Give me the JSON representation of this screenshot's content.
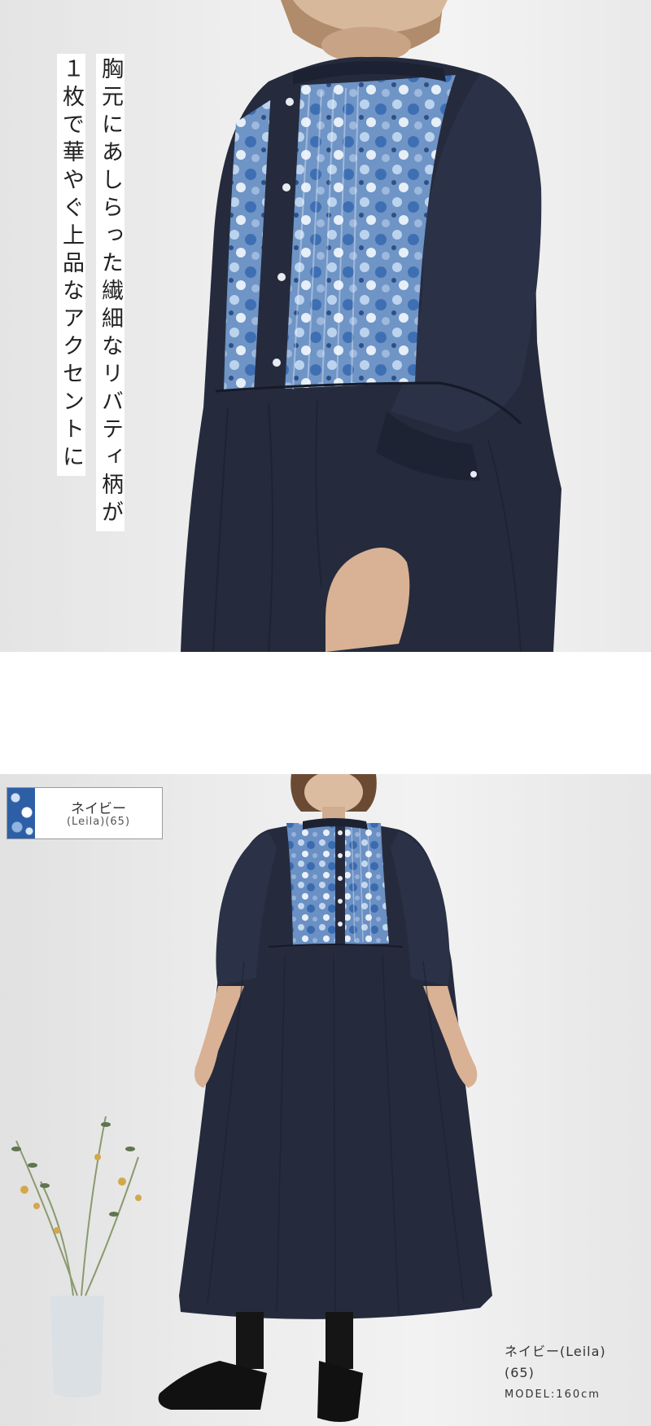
{
  "top_section": {
    "vertical_text": [
      "胸元にあしらった繊細なリバティ柄が",
      "１枚で華やぐ上品なアクセントに"
    ]
  },
  "bottom_section": {
    "color_label": {
      "name": "ネイビー",
      "code": "(Leila)(65)",
      "swatch_colors": [
        "#2d5fa7",
        "#cfe0f3",
        "#8fb4e0"
      ]
    },
    "caption": {
      "line1": "ネイビー(Leila)",
      "line2": "(65)",
      "model": "MODEL:160cm"
    }
  },
  "colors": {
    "dress_navy": "#252b3d",
    "bib_pattern_blue": "#4f7fbf",
    "background_light": "#eeeeee"
  }
}
